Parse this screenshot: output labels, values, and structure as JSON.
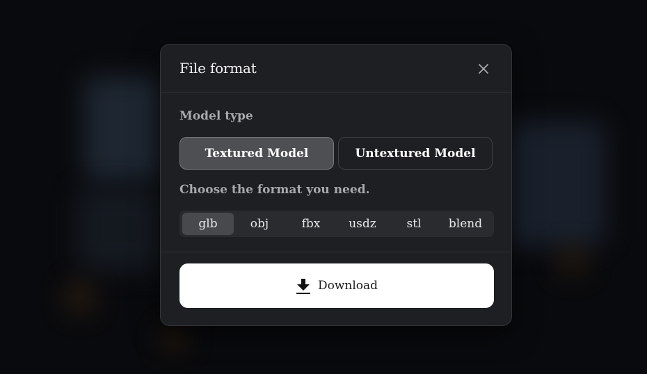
{
  "dialog": {
    "title": "File format",
    "close_icon": "close-icon"
  },
  "model_type": {
    "label": "Model type",
    "options": [
      {
        "label": "Textured Model",
        "selected": true
      },
      {
        "label": "Untextured Model",
        "selected": false
      }
    ]
  },
  "format": {
    "label": "Choose the format you need.",
    "options": [
      {
        "label": "glb",
        "selected": true
      },
      {
        "label": "obj",
        "selected": false
      },
      {
        "label": "fbx",
        "selected": false
      },
      {
        "label": "usdz",
        "selected": false
      },
      {
        "label": "stl",
        "selected": false
      },
      {
        "label": "blend",
        "selected": false
      }
    ]
  },
  "download": {
    "label": "Download",
    "icon": "download-icon"
  },
  "colors": {
    "modal_bg": "#1e1f22",
    "selected_bg": "#4e4f52",
    "download_bg": "#ffffff"
  }
}
